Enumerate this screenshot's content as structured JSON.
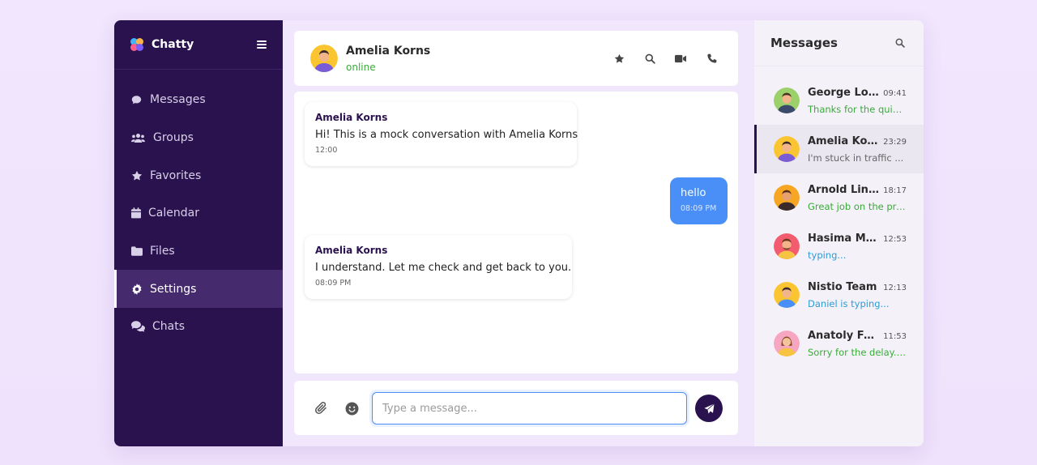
{
  "brand": {
    "name": "Chatty"
  },
  "sidebar": {
    "items": [
      {
        "label": "Messages",
        "icon": "chat-bubble-icon"
      },
      {
        "label": "Groups",
        "icon": "users-icon"
      },
      {
        "label": "Favorites",
        "icon": "star-icon"
      },
      {
        "label": "Calendar",
        "icon": "calendar-icon"
      },
      {
        "label": "Files",
        "icon": "folder-icon"
      },
      {
        "label": "Settings",
        "icon": "gear-icon",
        "active": true
      },
      {
        "label": "Chats",
        "icon": "comments-icon"
      }
    ]
  },
  "chat": {
    "contact_name": "Amelia Korns",
    "status": "online",
    "messages": [
      {
        "direction": "in",
        "sender": "Amelia Korns",
        "text": "Hi! This is a mock conversation with Amelia Korns",
        "time": "12:00"
      },
      {
        "direction": "out",
        "text": "hello",
        "time": "08:09 PM"
      },
      {
        "direction": "in",
        "sender": "Amelia Korns",
        "text": "I understand. Let me check and get back to you.",
        "time": "08:09 PM"
      }
    ],
    "input_placeholder": "Type a message..."
  },
  "panel": {
    "title": "Messages",
    "conversations": [
      {
        "name": "George Lobko",
        "time": "09:41",
        "preview": "Thanks for the quick...",
        "preview_style": "green"
      },
      {
        "name": "Amelia Korns",
        "time": "23:29",
        "preview": "I'm stuck in traffic ...",
        "preview_style": "gray",
        "active": true
      },
      {
        "name": "Arnold Linkeln",
        "time": "18:17",
        "preview": "Great job on the pre...",
        "preview_style": "green"
      },
      {
        "name": "Hasima Med...",
        "time": "12:53",
        "preview": "typing...",
        "preview_style": "blue"
      },
      {
        "name": "Nistio Team",
        "time": "12:13",
        "preview": "Daniel is typing...",
        "preview_style": "blue"
      },
      {
        "name": "Anatoly Ferus...",
        "time": "11:53",
        "preview": "Sorry for the delay. I'...",
        "preview_style": "green"
      }
    ]
  },
  "colors": {
    "sidebar_bg": "#2a124f",
    "accent_blue": "#4a8ff7",
    "online_green": "#3aaa3a",
    "typing_blue": "#2f9bd6"
  }
}
